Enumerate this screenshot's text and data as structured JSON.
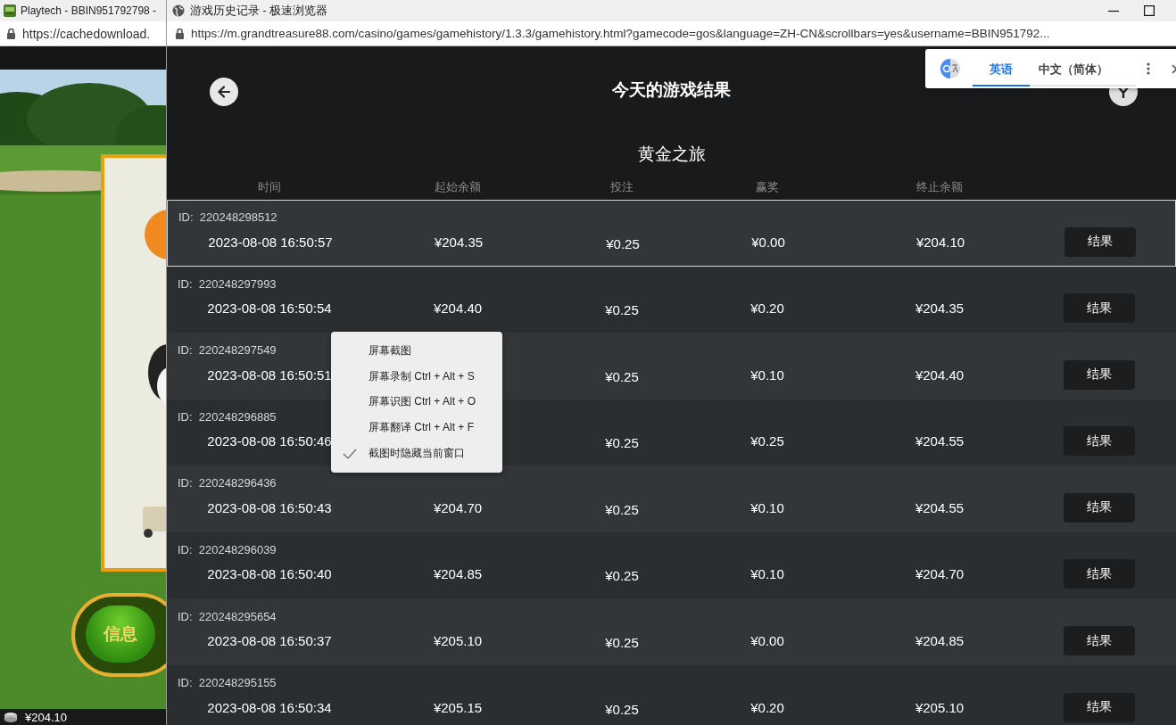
{
  "background_window": {
    "title": "Playtech - BBIN951792798 -",
    "url": "https://cachedownload.",
    "info_button": "信息",
    "balance": "¥204.10"
  },
  "window": {
    "title": "游戏历史记录 - 极速浏览器",
    "url": "https://m.grandtreasure88.com/casino/games/gamehistory/1.3.3/gamehistory.html?gamecode=gos&language=ZH-CN&scrollbars=yes&username=BBIN951792..."
  },
  "page": {
    "title": "今天的游戏结果",
    "game_name": "黄金之旅",
    "columns": [
      "时间",
      "起始余额",
      "投注",
      "赢奖",
      "终止余额"
    ],
    "rows": [
      {
        "id": "ID:  220248298512",
        "time": "2023-08-08 16:50:57",
        "start": "¥204.35",
        "bet": "¥0.25",
        "win": "¥0.00",
        "end": "¥204.10",
        "button": "结果",
        "selected": true
      },
      {
        "id": "ID:  220248297993",
        "time": "2023-08-08 16:50:54",
        "start": "¥204.40",
        "bet": "¥0.25",
        "win": "¥0.20",
        "end": "¥204.35",
        "button": "结果",
        "selected": false
      },
      {
        "id": "ID:  220248297549",
        "time": "2023-08-08 16:50:51",
        "bet": "¥0.25",
        "win": "¥0.10",
        "end": "¥204.40",
        "button": "结果",
        "selected": false
      },
      {
        "id": "ID:  220248296885",
        "time": "2023-08-08 16:50:46",
        "bet": "¥0.25",
        "win": "¥0.25",
        "end": "¥204.55",
        "button": "结果",
        "selected": false
      },
      {
        "id": "ID:  220248296436",
        "time": "2023-08-08 16:50:43",
        "start": "¥204.70",
        "bet": "¥0.25",
        "win": "¥0.10",
        "end": "¥204.55",
        "button": "结果",
        "selected": false
      },
      {
        "id": "ID:  220248296039",
        "time": "2023-08-08 16:50:40",
        "start": "¥204.85",
        "bet": "¥0.25",
        "win": "¥0.10",
        "end": "¥204.70",
        "button": "结果",
        "selected": false
      },
      {
        "id": "ID:  220248295654",
        "time": "2023-08-08 16:50:37",
        "start": "¥205.10",
        "bet": "¥0.25",
        "win": "¥0.00",
        "end": "¥204.85",
        "button": "结果",
        "selected": false
      },
      {
        "id": "ID:  220248295155",
        "time": "2023-08-08 16:50:34",
        "start": "¥205.15",
        "bet": "¥0.25",
        "win": "¥0.20",
        "end": "¥205.10",
        "button": "结果",
        "selected": false
      }
    ]
  },
  "context_menu": {
    "items": [
      {
        "label": "屏幕截图",
        "checked": false
      },
      {
        "label": "屏幕录制 Ctrl + Alt + S",
        "checked": false
      },
      {
        "label": "屏幕识图 Ctrl + Alt + O",
        "checked": false
      },
      {
        "label": "屏幕翻译 Ctrl + Alt + F",
        "checked": false
      },
      {
        "label": "截图时隐藏当前窗口",
        "checked": true
      }
    ]
  },
  "translate_bar": {
    "tabs": [
      {
        "label": "英语",
        "selected": true
      },
      {
        "label": "中文（简体）",
        "selected": false
      }
    ]
  }
}
